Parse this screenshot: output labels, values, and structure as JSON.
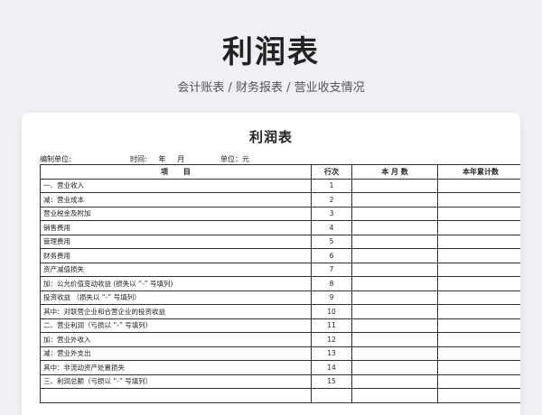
{
  "header": {
    "title": "利润表",
    "subtitle": "会计账表 / 财务报表 / 营业收支情况"
  },
  "sheet": {
    "title": "利润表",
    "company_label": "编制单位:",
    "time_label": "时间:     年     月",
    "unit_label": "单位：元",
    "columns": [
      "项      目",
      "行次",
      "本 月 数",
      "本年累计数"
    ],
    "rows": [
      {
        "item": "一、营业收入",
        "line": "1",
        "indent": 0
      },
      {
        "item": "减：营业成本",
        "line": "2",
        "indent": 1
      },
      {
        "item": "营业税金及附加",
        "line": "3",
        "indent": 2
      },
      {
        "item": "销售费用",
        "line": "4",
        "indent": 2
      },
      {
        "item": "管理费用",
        "line": "5",
        "indent": 2
      },
      {
        "item": "财务费用",
        "line": "6",
        "indent": 2
      },
      {
        "item": "资产减值损失",
        "line": "7",
        "indent": 2
      },
      {
        "item": "加：公允价值变动收益 (损失以 “-” 号填列)",
        "line": "8",
        "indent": 1
      },
      {
        "item": "投资收益 （损失以 “-” 号填列）",
        "line": "9",
        "indent": 2
      },
      {
        "item": "其中：对联营企业和合营企业的投资收益",
        "line": "10",
        "indent": 2
      },
      {
        "item": "二、营业利润（亏损以 “-” 号填列）",
        "line": "11",
        "indent": 0
      },
      {
        "item": "加：营业外收入",
        "line": "12",
        "indent": 1
      },
      {
        "item": "减：营业外支出",
        "line": "13",
        "indent": 1
      },
      {
        "item": "其中：非流动资产处置损失",
        "line": "14",
        "indent": 2
      },
      {
        "item": "三、利润总额（亏损以 “-” 号填列）",
        "line": "15",
        "indent": 0
      },
      {
        "item": "",
        "line": "",
        "indent": 0
      }
    ]
  }
}
